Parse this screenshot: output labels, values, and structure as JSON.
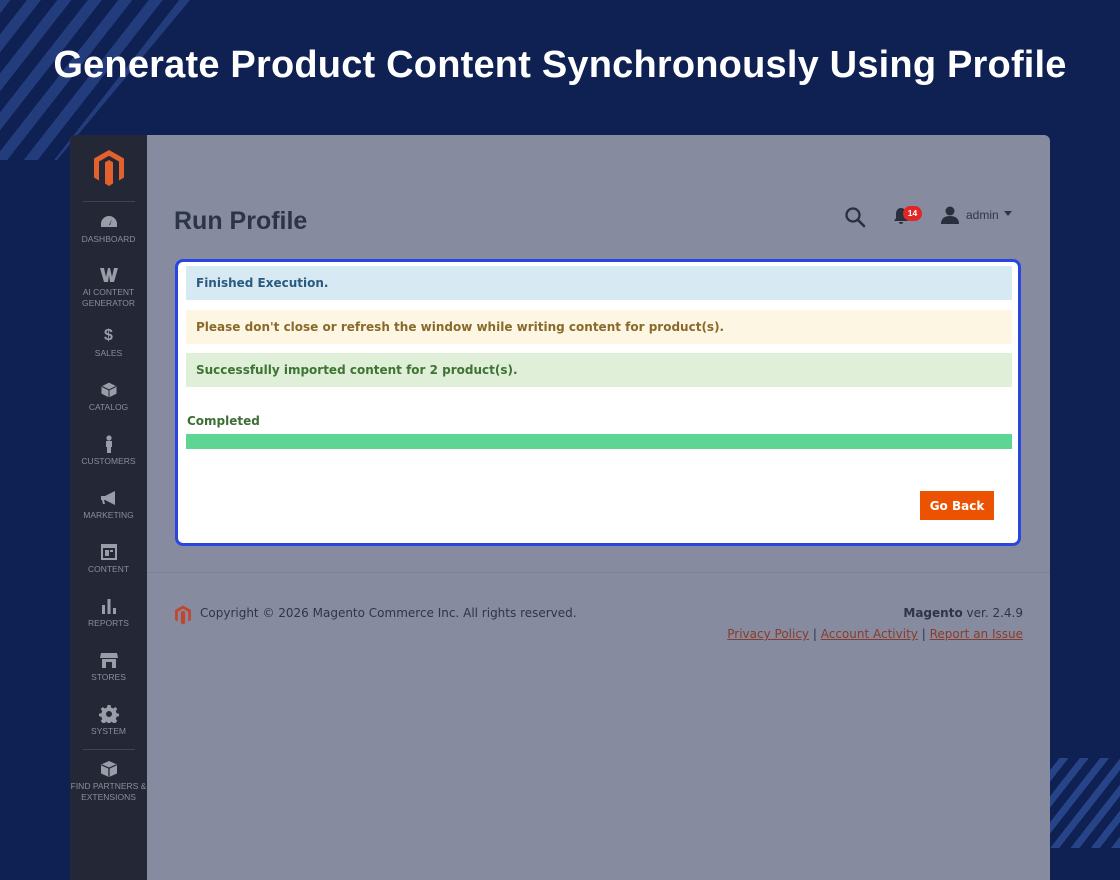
{
  "hero": {
    "title": "Generate Product Content Synchronously Using Profile"
  },
  "sidebar": {
    "items": [
      {
        "label": "DASHBOARD",
        "icon": "dashboard-icon"
      },
      {
        "label": "AI CONTENT GENERATOR",
        "icon": "ai-content-icon"
      },
      {
        "label": "SALES",
        "icon": "dollar-icon"
      },
      {
        "label": "CATALOG",
        "icon": "box-icon"
      },
      {
        "label": "CUSTOMERS",
        "icon": "person-icon"
      },
      {
        "label": "MARKETING",
        "icon": "megaphone-icon"
      },
      {
        "label": "CONTENT",
        "icon": "layout-icon"
      },
      {
        "label": "REPORTS",
        "icon": "bar-chart-icon"
      },
      {
        "label": "STORES",
        "icon": "storefront-icon"
      },
      {
        "label": "SYSTEM",
        "icon": "gear-icon"
      },
      {
        "label": "FIND PARTNERS & EXTENSIONS",
        "icon": "cube-icon"
      }
    ]
  },
  "header": {
    "page_title": "Run Profile",
    "notification_count": "14",
    "user_name": "admin"
  },
  "messages": {
    "info": "Finished Execution.",
    "warning": "Please don't close or refresh the window while writing content for product(s).",
    "success": "Successfully imported content for 2 product(s)."
  },
  "progress": {
    "label": "Completed",
    "percent": 100
  },
  "actions": {
    "go_back": "Go Back"
  },
  "footer": {
    "copyright": "Copyright © 2026 Magento Commerce Inc. All rights reserved.",
    "brand": "Magento",
    "version": "ver. 2.4.9",
    "links": [
      "Privacy Policy",
      "Account Activity",
      "Report an Issue"
    ]
  },
  "colors": {
    "accent": "#eb5202",
    "panel_border": "#2a46e0",
    "progress_fill": "#5cd692"
  }
}
